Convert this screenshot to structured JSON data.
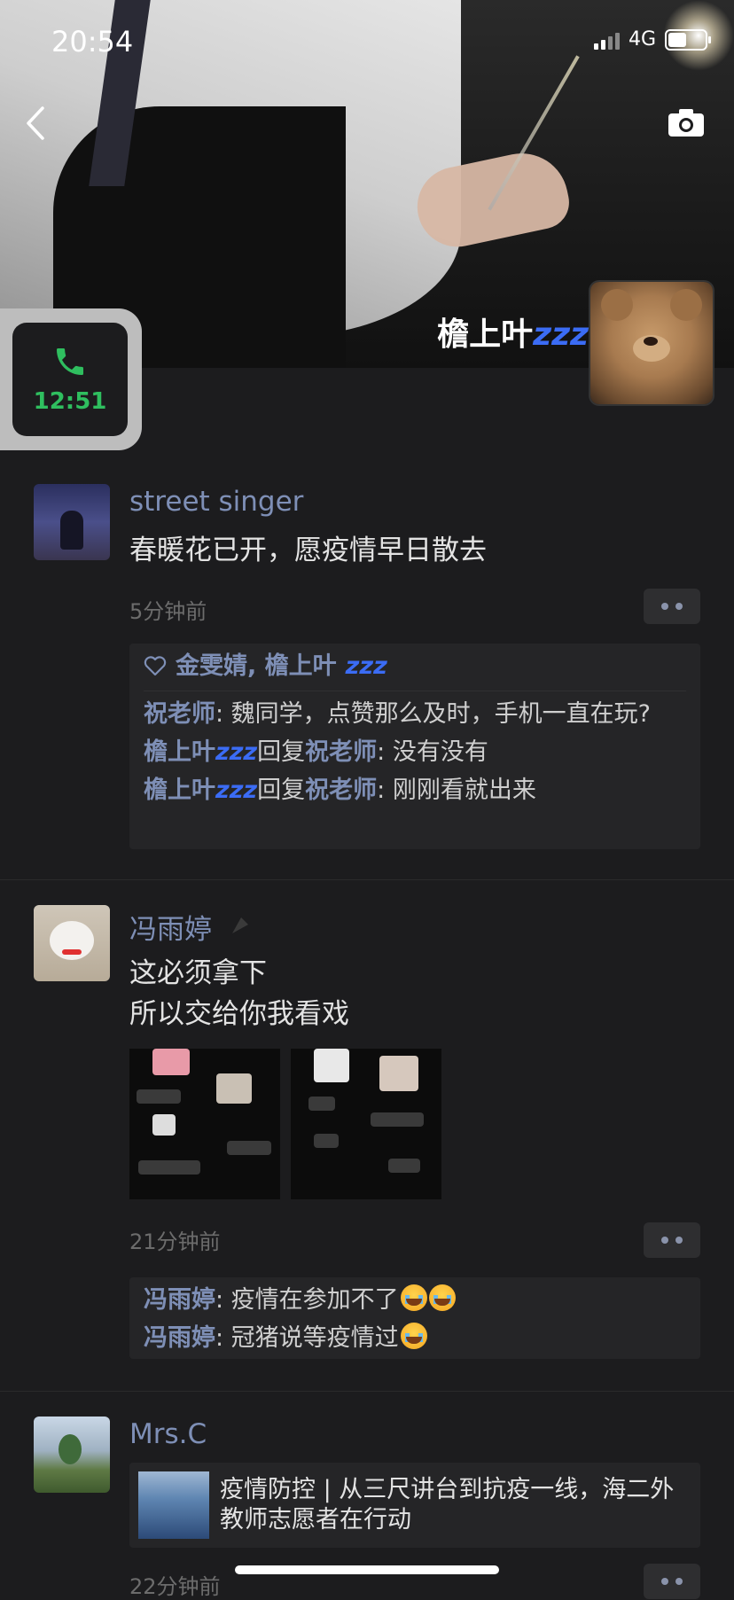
{
  "status_bar": {
    "time": "20:54",
    "network": "4G"
  },
  "profile": {
    "name": "檐上叶",
    "zzz": "zzz"
  },
  "call_float": {
    "duration": "12:51",
    "icon": "phone-icon"
  },
  "posts": [
    {
      "author": "street singer",
      "text": "春暖花已开，愿疫情早日散去",
      "time": "5分钟前",
      "likes": "金雯婧, 檐上叶",
      "comments": [
        {
          "name": "祝老师",
          "text": ": 魏同学，点赞那么及时，手机一直在玩?"
        },
        {
          "name": "檐上叶",
          "reply": "回复",
          "to": "祝老师",
          "text": ": 没有没有"
        },
        {
          "name": "檐上叶",
          "reply": "回复",
          "to": "祝老师",
          "text": ": 刚刚看就出来"
        }
      ]
    },
    {
      "author": "冯雨婷",
      "text_line1": "这必须拿下",
      "text_line2": "所以交给你我看戏",
      "time": "21分钟前",
      "comments": [
        {
          "name": "冯雨婷",
          "text": ": 疫情在参加不了"
        },
        {
          "name": "冯雨婷",
          "text": ": 冠猪说等疫情过"
        }
      ]
    },
    {
      "author": "Mrs.C",
      "article_title": "疫情防控 | 从三尺讲台到抗疫一线，海二外教师志愿者在行动",
      "time": "22分钟前"
    }
  ]
}
